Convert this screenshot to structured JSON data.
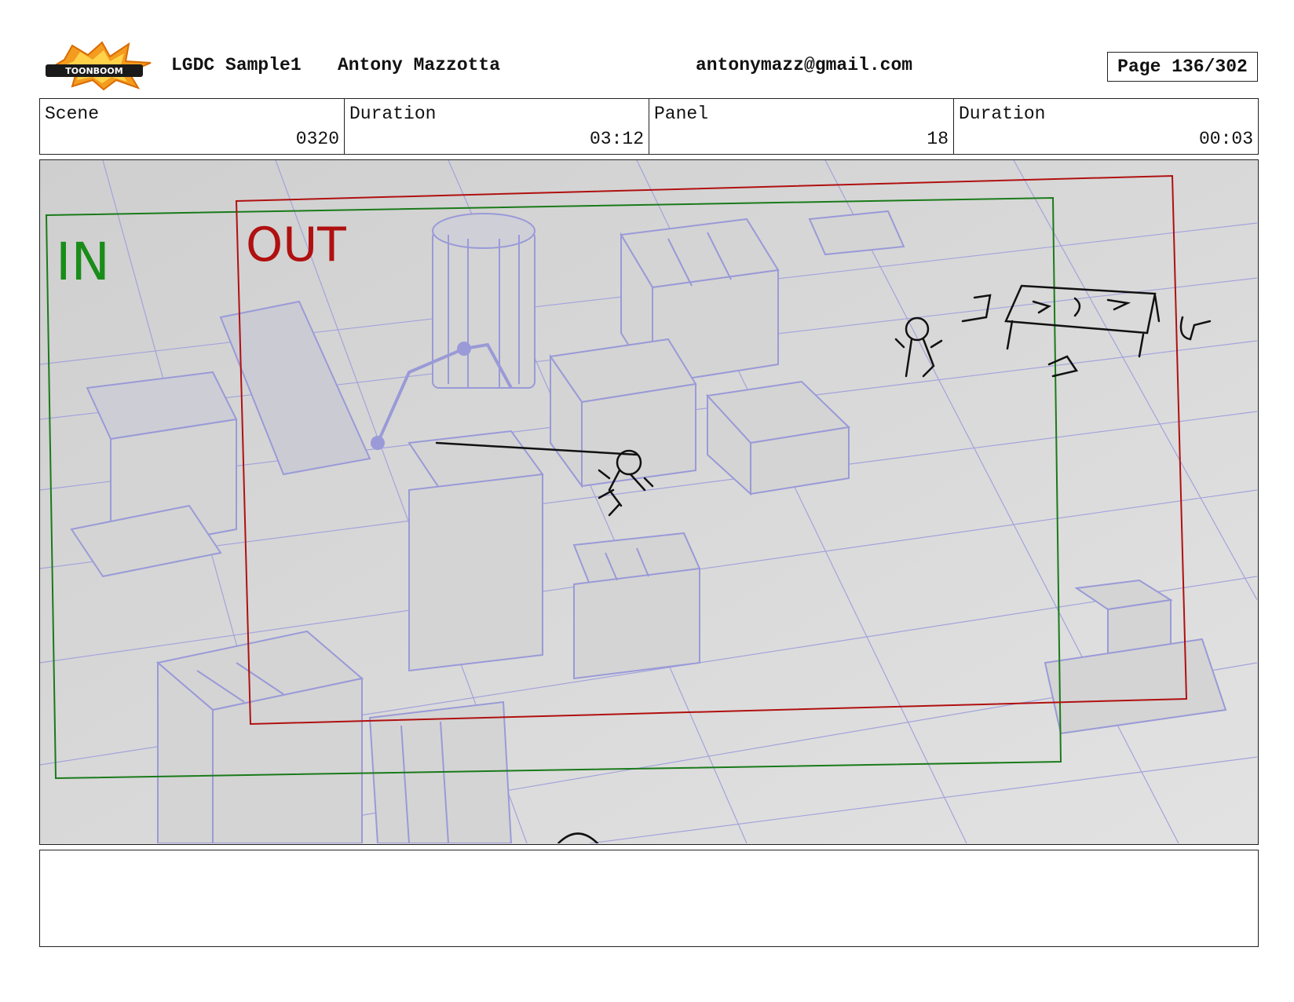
{
  "header": {
    "logo_text": "TOONBOOM",
    "project": "LGDC Sample1",
    "author": "Antony Mazzotta",
    "email": "antonymazz@gmail.com",
    "page": "Page 136/302"
  },
  "info": {
    "scene_label": "Scene",
    "scene_value": "0320",
    "scene_duration_label": "Duration",
    "scene_duration_value": "03:12",
    "panel_label": "Panel",
    "panel_value": "18",
    "panel_duration_label": "Duration",
    "panel_duration_value": "00:03"
  },
  "panel_image": {
    "in_label": "IN",
    "out_label": "OUT",
    "in_color": "#1a8c1a",
    "out_color": "#b01010",
    "line_color": "#9a9ad8",
    "background_color": "#dadada"
  },
  "notes": {
    "text": ""
  }
}
